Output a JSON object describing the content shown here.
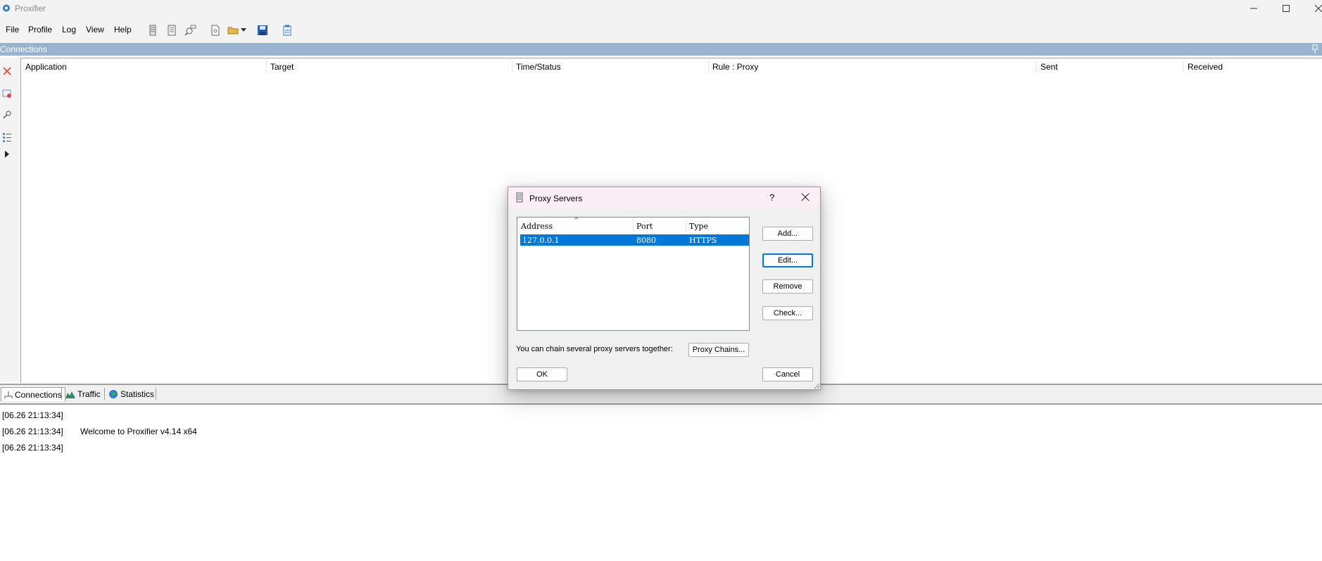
{
  "window": {
    "title": "Proxifier"
  },
  "menu": {
    "file": "File",
    "profile": "Profile",
    "log": "Log",
    "view": "View",
    "help": "Help"
  },
  "connections_panel": {
    "title": "Connections",
    "columns": [
      "Application",
      "Target",
      "Time/Status",
      "Rule : Proxy",
      "Sent",
      "Received"
    ]
  },
  "bottom_tabs": [
    "Connections",
    "Traffic",
    "Statistics"
  ],
  "log": [
    {
      "time": "[06.26 21:13:34]",
      "message": ""
    },
    {
      "time": "[06.26 21:13:34]",
      "message": "Welcome to Proxifier v4.14 x64"
    },
    {
      "time": "[06.26 21:13:34]",
      "message": ""
    }
  ],
  "dialog": {
    "title": "Proxy Servers",
    "help_glyph": "?",
    "list_columns": [
      "Address",
      "Port",
      "Type"
    ],
    "sort_indicator": "^",
    "rows": [
      {
        "address": "127.0.0.1",
        "port": "8080",
        "type": "HTTPS"
      }
    ],
    "buttons": {
      "add": "Add...",
      "edit": "Edit...",
      "remove": "Remove",
      "check": "Check...",
      "proxy_chains": "Proxy Chains...",
      "ok": "OK",
      "cancel": "Cancel"
    },
    "chain_text": "You can chain several proxy servers together:"
  },
  "colors": {
    "selection": "#0078d7",
    "panel_header": "#99b4d1",
    "dialog_title_bg": "#fbeef4"
  }
}
